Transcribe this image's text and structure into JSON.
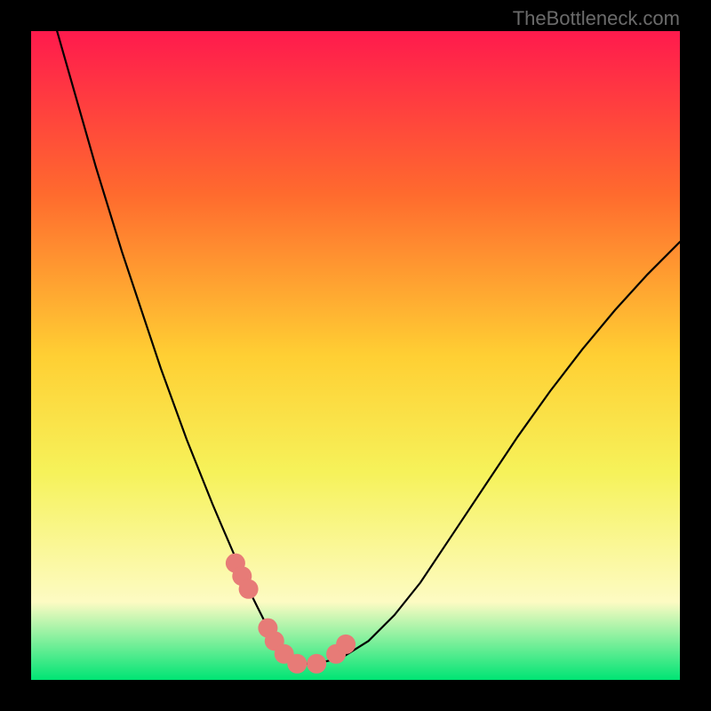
{
  "watermark": "TheBottleneck.com",
  "chart_data": {
    "type": "line",
    "title": "",
    "xlabel": "",
    "ylabel": "",
    "xlim": [
      0,
      100
    ],
    "ylim": [
      0,
      100
    ],
    "grid": false,
    "legend": false,
    "series": [
      {
        "name": "curve",
        "x": [
          4,
          6,
          8,
          10,
          12,
          14,
          16,
          18,
          20,
          22,
          24,
          26,
          28,
          29.5,
          31,
          32.5,
          33.5,
          35,
          36,
          37.5,
          39,
          41,
          44,
          48,
          52,
          56,
          60,
          65,
          70,
          75,
          80,
          85,
          90,
          95,
          100
        ],
        "y": [
          100,
          93,
          86,
          79,
          72.5,
          66,
          60,
          54,
          48,
          42.5,
          37,
          32,
          27,
          23.5,
          20,
          16.5,
          14,
          11,
          9,
          6,
          4,
          2.5,
          2.5,
          3.5,
          6,
          10,
          15,
          22.5,
          30,
          37.5,
          44.5,
          51,
          57,
          62.5,
          67.5
        ]
      },
      {
        "name": "markers",
        "x": [
          31.5,
          32.5,
          33.5,
          36.5,
          37.5,
          39,
          41,
          44,
          47,
          48.5
        ],
        "y": [
          18,
          16,
          14,
          8,
          6,
          4,
          2.5,
          2.5,
          4,
          5.5
        ]
      }
    ],
    "gradient_colors": {
      "top": "#ff1a4d",
      "upper_mid": "#ff6a2e",
      "mid": "#ffcf33",
      "lower_mid": "#f6f25a",
      "low": "#fdfbc3",
      "bottom": "#00e474"
    }
  }
}
